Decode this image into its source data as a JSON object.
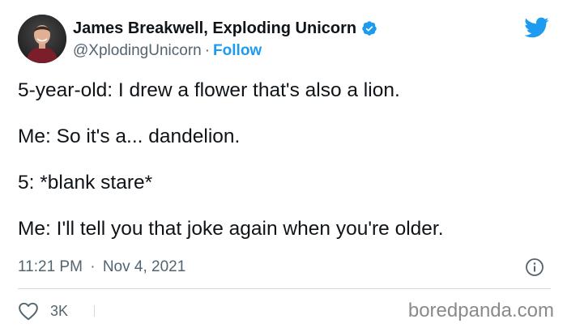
{
  "author": {
    "name": "James Breakwell, Exploding Unicorn",
    "handle": "@XplodingUnicorn",
    "separator": "·",
    "follow_label": "Follow"
  },
  "tweet": {
    "lines": [
      "5-year-old: I drew a flower that's also a lion.",
      "Me: So it's a... dandelion.",
      "5: *blank stare*",
      "Me: I'll tell you that joke again when you're older."
    ],
    "time": "11:21 PM",
    "separator": "·",
    "date": "Nov 4, 2021"
  },
  "actions": {
    "like_count": "3K"
  },
  "watermark": "boredpanda.com",
  "icons": {
    "verified": "verified-badge-icon",
    "twitter": "twitter-bird-icon",
    "info": "info-icon",
    "like": "heart-icon"
  },
  "colors": {
    "accent": "#1d9bf0",
    "text_primary": "#0f1419",
    "text_secondary": "#536471",
    "divider": "#cfd9de",
    "watermark": "#8a8a8a"
  }
}
